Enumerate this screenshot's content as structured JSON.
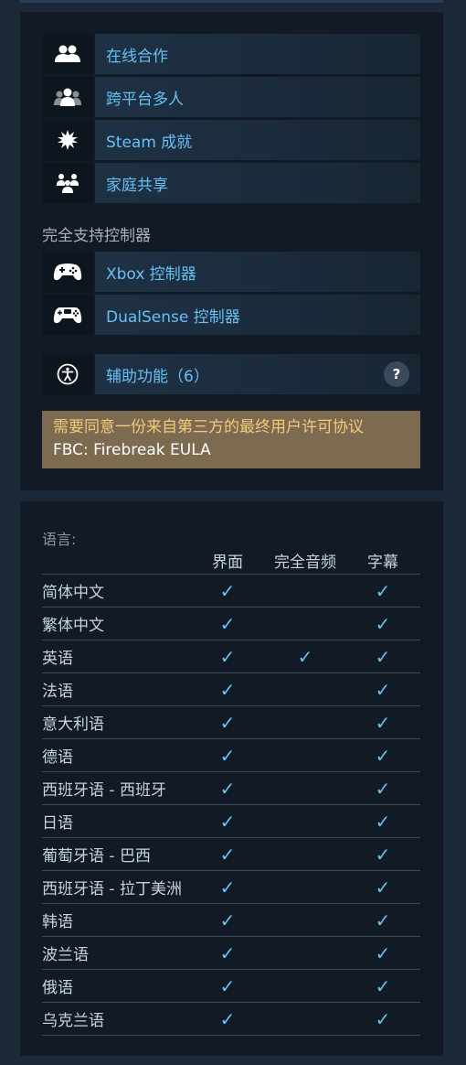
{
  "features": {
    "items": [
      {
        "label": "在线合作",
        "icon": "users-icon"
      },
      {
        "label": "跨平台多人",
        "icon": "multi-users-icon"
      },
      {
        "label": "Steam 成就",
        "icon": "achievement-icon"
      },
      {
        "label": "家庭共享",
        "icon": "family-icon"
      }
    ],
    "controller_heading": "完全支持控制器",
    "controllers": [
      {
        "label": "Xbox 控制器",
        "icon": "gamepad-icon"
      },
      {
        "label": "DualSense 控制器",
        "icon": "dualsense-icon"
      }
    ],
    "accessibility": {
      "label": "辅助功能（6）",
      "icon": "accessibility-icon",
      "help": "?"
    },
    "eula": {
      "title": "需要同意一份来自第三方的最终用户许可协议",
      "link": "FBC: Firebreak EULA"
    }
  },
  "languages": {
    "heading": "语言:",
    "columns": [
      "界面",
      "完全音频",
      "字幕"
    ],
    "check_glyph": "✓",
    "rows": [
      {
        "name": "简体中文",
        "ui": true,
        "audio": false,
        "sub": true
      },
      {
        "name": "繁体中文",
        "ui": true,
        "audio": false,
        "sub": true
      },
      {
        "name": "英语",
        "ui": true,
        "audio": true,
        "sub": true
      },
      {
        "name": "法语",
        "ui": true,
        "audio": false,
        "sub": true
      },
      {
        "name": "意大利语",
        "ui": true,
        "audio": false,
        "sub": true
      },
      {
        "name": "德语",
        "ui": true,
        "audio": false,
        "sub": true
      },
      {
        "name": "西班牙语 - 西班牙",
        "ui": true,
        "audio": false,
        "sub": true
      },
      {
        "name": "日语",
        "ui": true,
        "audio": false,
        "sub": true
      },
      {
        "name": "葡萄牙语 - 巴西",
        "ui": true,
        "audio": false,
        "sub": true
      },
      {
        "name": "西班牙语 - 拉丁美洲",
        "ui": true,
        "audio": false,
        "sub": true
      },
      {
        "name": "韩语",
        "ui": true,
        "audio": false,
        "sub": true
      },
      {
        "name": "波兰语",
        "ui": true,
        "audio": false,
        "sub": true
      },
      {
        "name": "俄语",
        "ui": true,
        "audio": false,
        "sub": true
      },
      {
        "name": "乌克兰语",
        "ui": true,
        "audio": false,
        "sub": true
      }
    ]
  },
  "colors": {
    "accent": "#66c0f4",
    "eula_bg": "#7c6b51",
    "panel_bg": "#111a25",
    "page_bg": "#1b2838"
  }
}
